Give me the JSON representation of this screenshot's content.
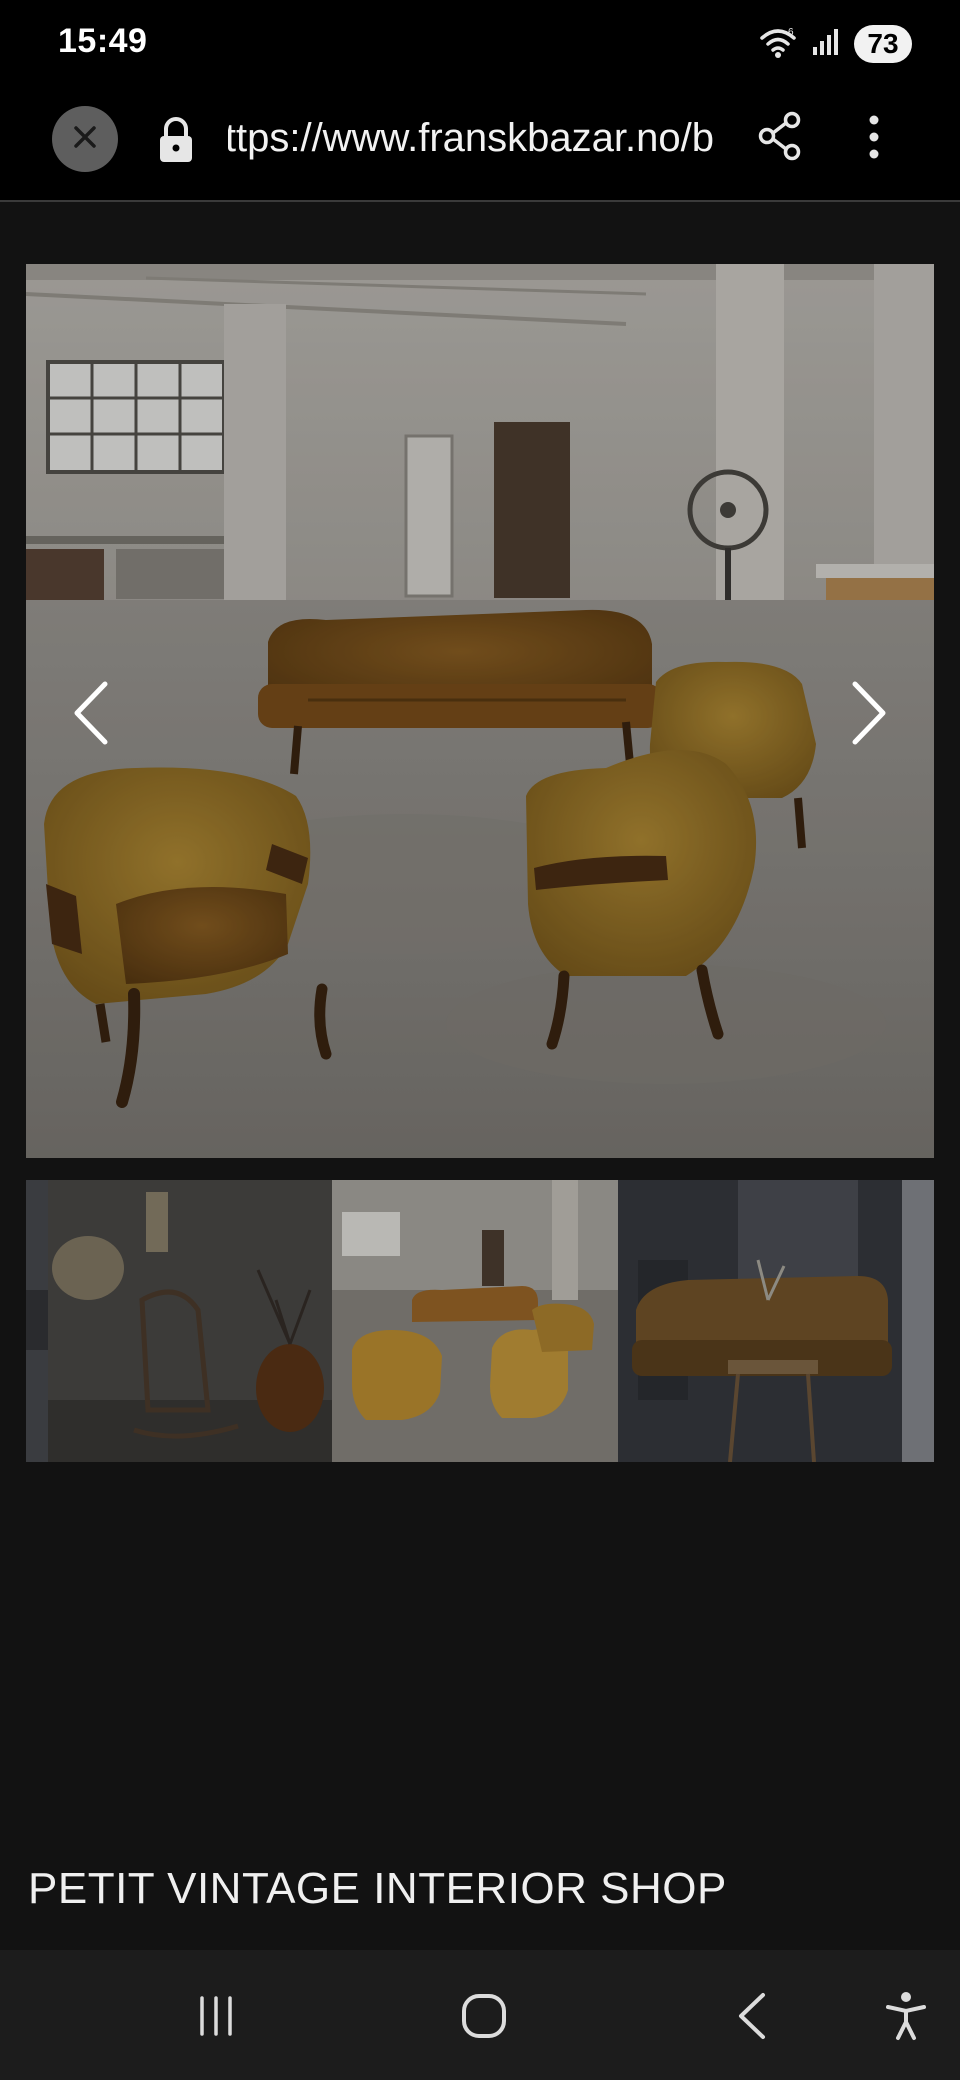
{
  "status_bar": {
    "time": "15:49",
    "battery": "73",
    "icons": [
      "wifi-icon",
      "signal-icon",
      "battery-icon"
    ]
  },
  "browser": {
    "url": "https://www.franskbazar.no/b",
    "icons": [
      "close-icon",
      "lock-icon",
      "share-icon",
      "more-vert-icon"
    ]
  },
  "gallery": {
    "prev_icon": "chevron-left-icon",
    "next_icon": "chevron-right-icon",
    "thumbnail_count": 4
  },
  "page": {
    "shop_title": "PETIT VINTAGE INTERIOR SHOP"
  },
  "nav_bar": {
    "icons": [
      "recent-apps-icon",
      "home-icon",
      "back-icon",
      "accessibility-icon"
    ]
  },
  "colors": {
    "background": "#121212",
    "toolbar": "#000000",
    "velvet_gold": "#a8822c",
    "navbar": "#1c1c1c"
  }
}
